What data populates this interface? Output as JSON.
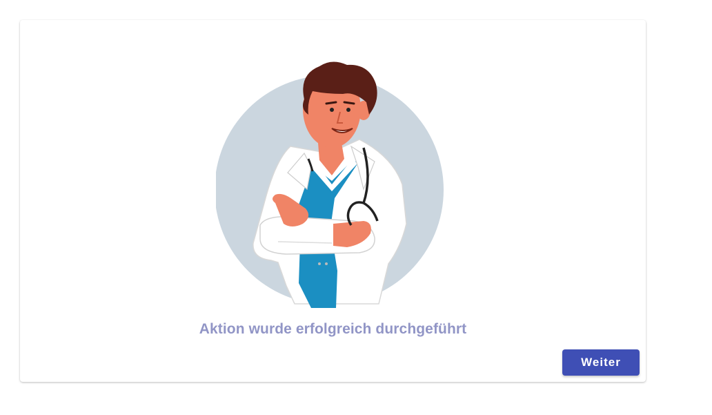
{
  "card": {
    "illustration": "doctor-illustration",
    "message": "Aktion wurde erfolgreich durchgeführt",
    "continue_label": "Weiter"
  },
  "colors": {
    "accent": "#3f4fb5",
    "message": "#9195c6",
    "circle": "#cbd6df"
  }
}
